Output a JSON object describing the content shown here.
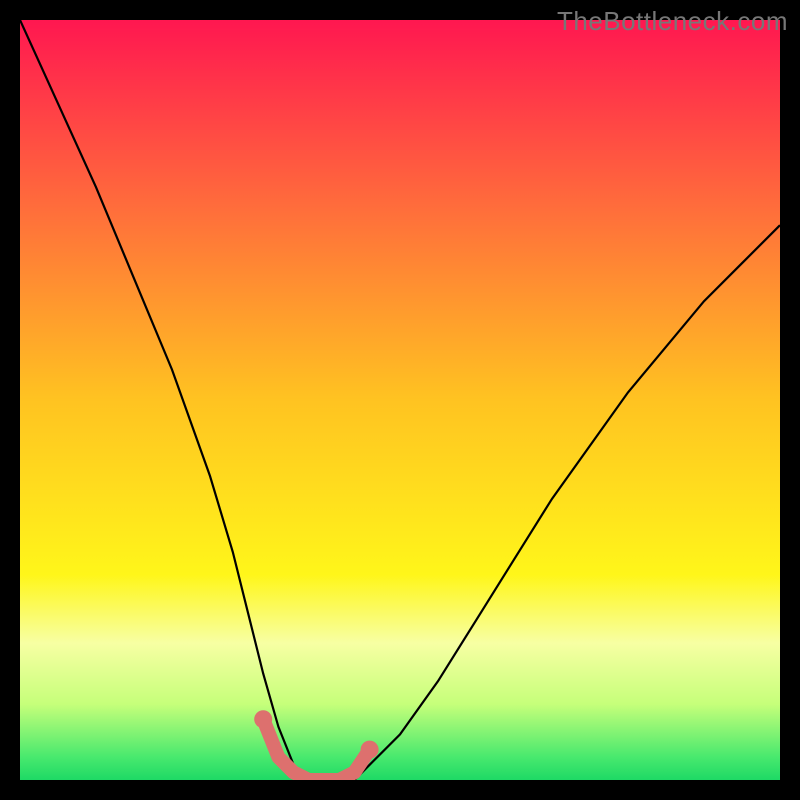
{
  "watermark": "TheBottleneck.com",
  "chart_data": {
    "type": "line",
    "title": "",
    "xlabel": "",
    "ylabel": "",
    "xlim": [
      0,
      100
    ],
    "ylim": [
      0,
      100
    ],
    "grid": false,
    "legend": false,
    "series": [
      {
        "name": "bottleneck-curve",
        "color": "#000000",
        "x": [
          0,
          5,
          10,
          15,
          20,
          25,
          28,
          30,
          32,
          34,
          36,
          38,
          40,
          42,
          44,
          46,
          50,
          55,
          60,
          65,
          70,
          75,
          80,
          85,
          90,
          95,
          100
        ],
        "y": [
          100,
          89,
          78,
          66,
          54,
          40,
          30,
          22,
          14,
          7,
          2,
          0,
          0,
          0,
          0,
          2,
          6,
          13,
          21,
          29,
          37,
          44,
          51,
          57,
          63,
          68,
          73
        ]
      },
      {
        "name": "optimal-band",
        "color": "#dd706e",
        "x": [
          32,
          34,
          36,
          38,
          40,
          42,
          44,
          46
        ],
        "y": [
          8,
          3,
          1,
          0,
          0,
          0,
          1,
          4
        ]
      }
    ],
    "background_gradient": {
      "type": "vertical",
      "stops": [
        {
          "offset": 0.0,
          "color": "#ff1750"
        },
        {
          "offset": 0.25,
          "color": "#ff6e3b"
        },
        {
          "offset": 0.5,
          "color": "#ffc321"
        },
        {
          "offset": 0.73,
          "color": "#fff61a"
        },
        {
          "offset": 0.82,
          "color": "#f7ffa3"
        },
        {
          "offset": 0.9,
          "color": "#c6ff7a"
        },
        {
          "offset": 0.97,
          "color": "#48e96e"
        },
        {
          "offset": 1.0,
          "color": "#1ed965"
        }
      ]
    }
  }
}
